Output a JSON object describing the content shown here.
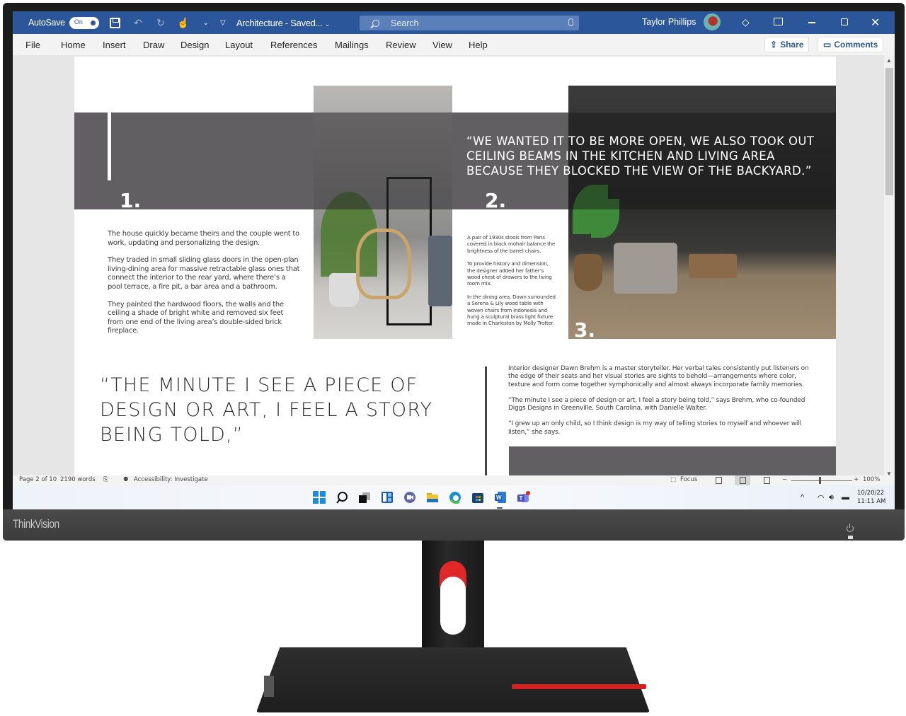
{
  "device": {
    "brand": "ThinkVision",
    "accent_color": "#e02828"
  },
  "word": {
    "titlebar": {
      "autosave_label": "AutoSave",
      "autosave_state": "On",
      "document_title": "Architecture - Saved...",
      "search_placeholder": "Search",
      "user_name": "Taylor Phillips",
      "brand_color": "#2b579a"
    },
    "menu": {
      "items": [
        "File",
        "Home",
        "Insert",
        "Draw",
        "Design",
        "Layout",
        "References",
        "Mailings",
        "Review",
        "View",
        "Help"
      ],
      "share_label": "Share",
      "comments_label": "Comments"
    },
    "document": {
      "section_numbers": [
        "1.",
        "2.",
        "3."
      ],
      "pull_quote_top": "“WE WANTED IT TO BE MORE OPEN, WE ALSO TOOK OUT CEILING BEAMS IN THE KITCHEN AND LIVING AREA BECAUSE THEY BLOCKED THE VIEW OF THE BACKYARD.”",
      "column1": [
        "The house quickly became theirs and the couple went to work, updating and personalizing the design.",
        "They traded in small sliding glass doors in the open-plan living-dining area for massive retractable glass ones that connect the interior to the rear yard, where there’s a pool terrace, a fire pit, a bar area and a bathroom.",
        "They painted the hardwood floors, the walls and the ceiling a shade of bright white and removed six feet from one end of the living area’s double-sided brick fireplace."
      ],
      "column2": [
        "A pair of 1930s stools from Paris covered in black mohair balance the brightness of the barrel chairs.",
        "To provide history and dimension, the designer added her father’s wood chest of drawers to the living room mix.",
        "In the dining area, Dawn surrounded a Serena & Lily wood table with woven chairs from Indonesia and hung a sculptural brass light fixture made in Charleston by Molly Trotter."
      ],
      "pull_quote_bottom": "“THE MINUTE I SEE A PIECE OF DESIGN OR ART, I FEEL A STORY BEING TOLD,”",
      "column3": [
        "Interior designer Dawn Brehm is a master storyteller. Her verbal tales consistently put listeners on the edge of their seats and her visual stories are sights to behold—arrangements where color, texture and form come together symphonically and almost always incorporate family memories.",
        "“The minute I see a piece of design or art, I feel a story being told,” says Brehm, who co-founded Diggs Designs in Greenville, South Carolina, with Danielle Walter.",
        "“I grew up an only child, so I think design is my way of telling stories to myself and whoever will listen,” she says."
      ]
    },
    "statusbar": {
      "page_info": "Page 2 of 10",
      "word_count": "2190 words",
      "accessibility": "Accessibility: Investigate",
      "focus_label": "Focus",
      "zoom_minus": "−",
      "zoom_plus": "+",
      "zoom_level": "100%",
      "zoom_percent": 100
    }
  },
  "taskbar": {
    "apps": [
      "start",
      "search",
      "task-view",
      "widgets",
      "teams-chat",
      "file-explorer",
      "edge",
      "store",
      "word",
      "teams"
    ],
    "active_app": "word",
    "tray_chevron": "^",
    "date": "10/20/22",
    "time": "11:11 AM"
  }
}
